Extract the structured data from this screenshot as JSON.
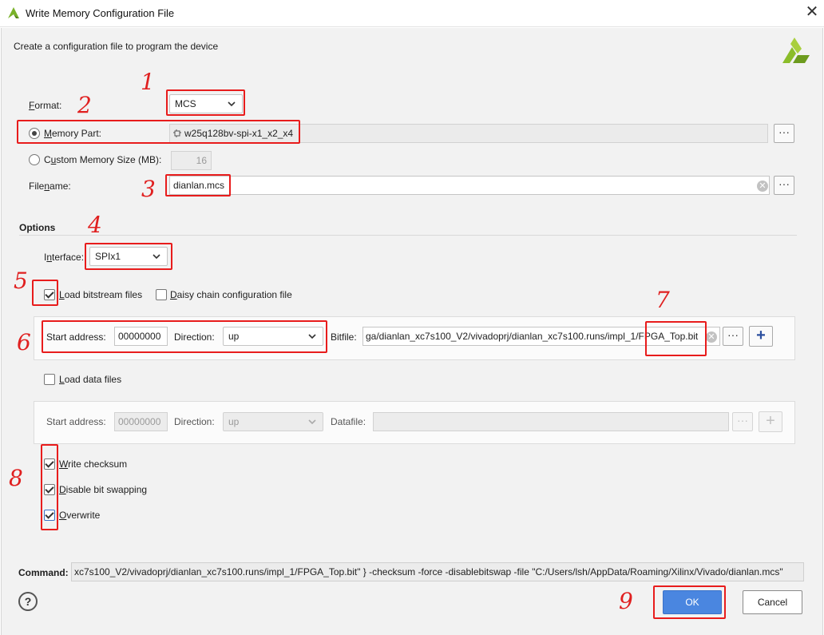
{
  "window": {
    "title": "Write Memory Configuration File",
    "close_glyph": "✕"
  },
  "description": "Create a configuration file to program the device",
  "format": {
    "label": "Format:",
    "value": "MCS"
  },
  "memory_part": {
    "label": "Memory Part:",
    "value": "w25q128bv-spi-x1_x2_x4"
  },
  "custom_memory": {
    "label": "Custom Memory Size (MB):",
    "value": "16"
  },
  "filename": {
    "label": "Filename:",
    "value": "dianlan.mcs"
  },
  "options": {
    "heading": "Options"
  },
  "interface": {
    "label": "Interface:",
    "value": "SPIx1"
  },
  "load_bitstream": {
    "label": "Load bitstream files",
    "checked": true
  },
  "daisy_chain": {
    "label": "Daisy chain configuration file",
    "checked": false
  },
  "bitstream_row": {
    "start_label": "Start address:",
    "start_value": "00000000",
    "direction_label": "Direction:",
    "direction_value": "up",
    "bitfile_label": "Bitfile:",
    "bitfile_value": "ga/dianlan_xc7s100_V2/vivadoprj/dianlan_xc7s100.runs/impl_1/FPGA_Top.bit"
  },
  "load_data": {
    "label": "Load data files",
    "checked": false
  },
  "data_row": {
    "start_label": "Start address:",
    "start_value": "00000000",
    "direction_label": "Direction:",
    "direction_value": "up",
    "datafile_label": "Datafile:",
    "datafile_value": ""
  },
  "write_checksum": {
    "label": "Write checksum",
    "checked": true
  },
  "disable_bit_swapping": {
    "label": "Disable bit swapping",
    "checked": true
  },
  "overwrite": {
    "label": "Overwrite",
    "checked": true
  },
  "command": {
    "label": "Command:",
    "value": "xc7s100_V2/vivadoprj/dianlan_xc7s100.runs/impl_1/FPGA_Top.bit\" } -checksum -force -disablebitswap -file \"C:/Users/lsh/AppData/Roaming/Xilinx/Vivado/dianlan.mcs\""
  },
  "buttons": {
    "ok": "OK",
    "cancel": "Cancel",
    "help": "?",
    "dots": "···",
    "add": "+"
  },
  "annotations": [
    "1",
    "2",
    "3",
    "4",
    "5",
    "6",
    "7",
    "8",
    "9"
  ],
  "colors": {
    "annotation_red": "#e81c1c",
    "ok_blue": "#4a86e0",
    "xilinx_green": "#8bbd2a"
  }
}
